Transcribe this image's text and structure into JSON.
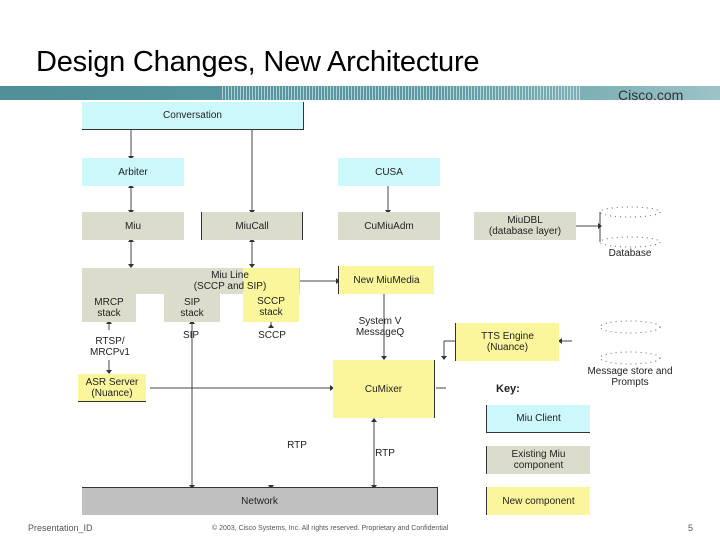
{
  "slide": {
    "title": "Design Changes, New Architecture",
    "brand": "Cisco.com",
    "footer_left": "Presentation_ID",
    "footer_center": "© 2003, Cisco Systems, Inc. All rights reserved. Proprietary and Confidential",
    "page_number": "5"
  },
  "colors": {
    "miu_client": "#ccf8fc",
    "existing_component": "#dcdccc",
    "new_component": "#fbf59c",
    "network": "#c0c0c0",
    "band": "#5b9aa3"
  },
  "components": {
    "conversation": "Conversation",
    "arbiter": "Arbiter",
    "cusa": "CUSA",
    "miu": "Miu",
    "miucall": "MiuCall",
    "cumiuadm": "CuMiuAdm",
    "miudbl_line1": "MiuDBL",
    "miudbl_line2": "(database layer)",
    "database": "Database",
    "miuline_line1": "Miu Line",
    "miuline_line2": "(SCCP and SIP)",
    "mrcp_line1": "MRCP",
    "mrcp_line2": "stack",
    "sip_line1": "SIP",
    "sip_line2": "stack",
    "sccp_line1": "SCCP",
    "sccp_line2": "stack",
    "newmiumedia": "New MiuMedia",
    "tts_line1": "TTS Engine",
    "tts_line2": "(Nuance)",
    "msgstore_line1": "Message store and",
    "msgstore_line2": "Prompts",
    "asr_line1": "ASR Server",
    "asr_line2": "(Nuance)",
    "cumixer": "CuMixer",
    "network": "Network"
  },
  "connections": {
    "rtsp_line1": "RTSP/",
    "rtsp_line2": "MRCPv1",
    "sip": "SIP",
    "sccp": "SCCP",
    "sysv_line1": "System V",
    "sysv_line2": "MessageQ",
    "rtp_left": "RTP",
    "rtp_right": "RTP"
  },
  "key": {
    "title": "Key:",
    "items": [
      {
        "label": "Miu Client"
      },
      {
        "label_line1": "Existing Miu",
        "label_line2": "component"
      },
      {
        "label": "New component"
      }
    ]
  }
}
